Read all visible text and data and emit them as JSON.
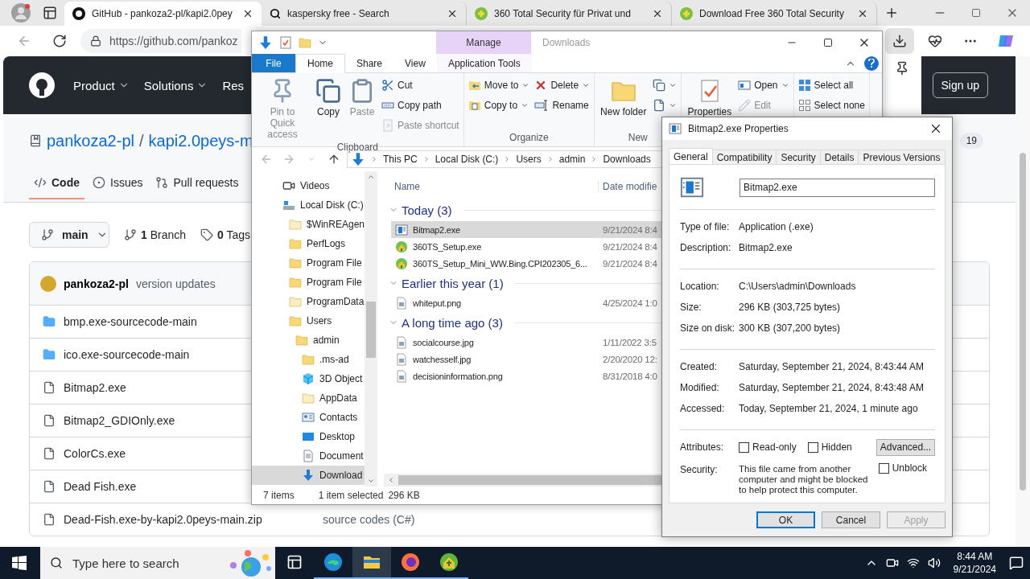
{
  "browser": {
    "tabs": [
      {
        "title": "GitHub - pankoza2-pl/kapi2.0pey",
        "kind": "github",
        "selected": true
      },
      {
        "title": "kaspersky free - Search",
        "kind": "search",
        "selected": false
      },
      {
        "title": "360 Total Security für Privat und",
        "kind": "shield",
        "selected": false
      },
      {
        "title": "Download Free 360 Total Security",
        "kind": "shield",
        "selected": false
      }
    ],
    "url": "https://github.com/pankoz"
  },
  "github": {
    "nav": [
      {
        "label": "Product",
        "dropdown": true
      },
      {
        "label": "Solutions",
        "dropdown": true
      },
      {
        "label": "Res",
        "dropdown": false
      }
    ],
    "sign_up": "Sign up",
    "owner": "pankoza2-pl",
    "separator": "/",
    "repo": "kapi2.0peys-m",
    "star_count": "19",
    "tabs": [
      {
        "label": "Code",
        "kind": "code",
        "selected": true
      },
      {
        "label": "Issues",
        "kind": "issues",
        "selected": false
      },
      {
        "label": "Pull requests",
        "kind": "pulls",
        "selected": false
      }
    ],
    "branch": "main",
    "branches": "**1** Branch",
    "tags": "**0** Tags",
    "commit": {
      "author": "pankoza2-pl",
      "message": "version updates"
    },
    "files": [
      {
        "name": "bmp.exe-sourcecode-main",
        "kind": "folder"
      },
      {
        "name": "ico.exe-sourcecode-main",
        "kind": "folder"
      },
      {
        "name": "Bitmap2.exe",
        "kind": "file"
      },
      {
        "name": "Bitmap2_GDIOnly.exe",
        "kind": "file"
      },
      {
        "name": "ColorCs.exe",
        "kind": "file"
      },
      {
        "name": "Dead Fish.exe",
        "kind": "file"
      },
      {
        "name": "Dead-Fish.exe-by-kapi2.0peys-main.zip",
        "kind": "file",
        "message": "source codes (C#)"
      }
    ]
  },
  "explorer": {
    "title": "Downloads",
    "contextual_group": "Manage",
    "ribbon_tabs": [
      {
        "label": "File",
        "kind": "file",
        "selected": false
      },
      {
        "label": "Home",
        "kind": "tab",
        "selected": true
      },
      {
        "label": "Share",
        "kind": "tab",
        "selected": false
      },
      {
        "label": "View",
        "kind": "tab",
        "selected": false
      },
      {
        "label": "Application Tools",
        "kind": "contextual",
        "selected": false
      }
    ],
    "ribbon": [
      {
        "label": "Clipboard",
        "columns": [
          [
            {
              "kind": "pin",
              "label": "Pin to Quick access",
              "disabled": true,
              "dropdown": false
            }
          ],
          [
            {
              "kind": "copy",
              "label": "Copy",
              "disabled": false,
              "dropdown": false
            }
          ],
          [
            {
              "kind": "paste",
              "label": "Paste",
              "disabled": true,
              "dropdown": false
            }
          ],
          [
            {
              "kind": "cut",
              "label": "Cut",
              "disabled": false,
              "dropdown": false
            },
            {
              "kind": "copy-path",
              "label": "Copy path",
              "disabled": false,
              "dropdown": false
            },
            {
              "kind": "paste-shortcut",
              "label": "Paste shortcut",
              "disabled": true,
              "dropdown": false
            }
          ]
        ]
      },
      {
        "label": "Organize",
        "columns": [
          [
            {
              "kind": "move",
              "label": "Move to",
              "disabled": false,
              "dropdown": true
            },
            {
              "kind": "copy-to",
              "label": "Copy to",
              "disabled": false,
              "dropdown": true
            }
          ],
          [
            {
              "kind": "delete",
              "label": "Delete",
              "disabled": false,
              "dropdown": true
            },
            {
              "kind": "rename",
              "label": "Rename",
              "disabled": false,
              "dropdown": false
            }
          ]
        ]
      },
      {
        "label": "New",
        "columns": [
          [
            {
              "kind": "new-folder",
              "label": "New folder",
              "disabled": false,
              "dropdown": false
            }
          ],
          [
            {
              "kind": "new-item",
              "disabled": false,
              "dropdown": true
            },
            {
              "kind": "easy-access",
              "disabled": false,
              "dropdown": true
            }
          ]
        ]
      },
      {
        "columns": [
          [
            {
              "kind": "properties",
              "label": "Properties",
              "disabled": false,
              "dropdown": false
            }
          ],
          [
            {
              "kind": "open",
              "label": "Open",
              "disabled": false,
              "dropdown": true
            },
            {
              "kind": "edit",
              "label": "Edit",
              "disabled": true,
              "dropdown": false
            }
          ]
        ]
      },
      {
        "columns": [
          [
            {
              "kind": "select-all",
              "label": "Select all",
              "disabled": false,
              "dropdown": false
            },
            {
              "kind": "select-none",
              "label": "Select none",
              "disabled": false,
              "dropdown": false
            }
          ]
        ]
      }
    ],
    "path": [
      "This PC",
      "Local Disk (C:)",
      "Users",
      "admin",
      "Downloads"
    ],
    "nav": [
      {
        "label": "Videos",
        "kind": "videos",
        "selected": false
      },
      {
        "label": "Local Disk (C:)",
        "kind": "drive",
        "selected": false,
        "children": [
          {
            "label": "$WinREAgen",
            "kind": "folder-faded",
            "selected": false
          },
          {
            "label": "PerfLogs",
            "kind": "folder",
            "selected": false
          },
          {
            "label": "Program File",
            "kind": "folder",
            "selected": false
          },
          {
            "label": "Program File",
            "kind": "folder",
            "selected": false
          },
          {
            "label": "ProgramData",
            "kind": "folder-faded",
            "selected": false
          },
          {
            "label": "Users",
            "kind": "folder",
            "selected": false,
            "children": [
              {
                "label": "admin",
                "kind": "folder",
                "selected": false,
                "children": [
                  {
                    "label": ".ms-ad",
                    "kind": "folder",
                    "selected": false
                  },
                  {
                    "label": "3D Object",
                    "kind": "cube",
                    "selected": false
                  },
                  {
                    "label": "AppData",
                    "kind": "folder-faded",
                    "selected": false
                  },
                  {
                    "label": "Contacts",
                    "kind": "contacts",
                    "selected": false
                  },
                  {
                    "label": "Desktop",
                    "kind": "desktop",
                    "selected": false
                  },
                  {
                    "label": "Document",
                    "kind": "documents",
                    "selected": false
                  },
                  {
                    "label": "Download",
                    "kind": "downloads",
                    "selected": true
                  }
                ]
              }
            ]
          }
        ]
      }
    ],
    "columns": [
      "Name",
      "Date modifie"
    ],
    "groups": [
      {
        "title": "Today (3)",
        "expanded": true,
        "files": [
          {
            "name": "Bitmap2.exe",
            "date": "9/21/2024 8:4",
            "kind": "app",
            "selected": true
          },
          {
            "name": "360TS_Setup.exe",
            "date": "9/21/2024 8:4",
            "kind": "installer",
            "selected": false
          },
          {
            "name": "360TS_Setup_Mini_WW.Bing.CPI202305_6...",
            "date": "9/21/2024 8:4",
            "kind": "installer",
            "selected": false
          }
        ]
      },
      {
        "title": "Earlier this year (1)",
        "expanded": true,
        "files": [
          {
            "name": "whiteput.png",
            "date": "4/25/2024 1:0",
            "kind": "image",
            "selected": false
          }
        ]
      },
      {
        "title": "A long time ago (3)",
        "expanded": true,
        "files": [
          {
            "name": "socialcourse.jpg",
            "date": "1/11/2022 3:5",
            "kind": "image",
            "selected": false
          },
          {
            "name": "watchesself.jpg",
            "date": "2/20/2020 12:",
            "kind": "image",
            "selected": false
          },
          {
            "name": "decisioninformation.png",
            "date": "8/31/2018 4:0",
            "kind": "image",
            "selected": false
          }
        ]
      }
    ],
    "status": {
      "count": "7 items",
      "selection": "1 item selected",
      "size": "296 KB"
    }
  },
  "dialog": {
    "title": "Bitmap2.exe Properties",
    "tabs": [
      {
        "label": "General",
        "selected": true
      },
      {
        "label": "Compatibility",
        "selected": false
      },
      {
        "label": "Security",
        "selected": false
      },
      {
        "label": "Details",
        "selected": false
      },
      {
        "label": "Previous Versions",
        "selected": false
      }
    ],
    "file_name": "Bitmap2.exe",
    "sections": [
      [
        {
          "label": "Type of file:",
          "value": "Application (.exe)"
        },
        {
          "label": "Description:",
          "value": "Bitmap2.exe"
        }
      ],
      [
        {
          "label": "Location:",
          "value": "C:\\Users\\admin\\Downloads"
        },
        {
          "label": "Size:",
          "value": "296 KB (303,725 bytes)"
        },
        {
          "label": "Size on disk:",
          "value": "300 KB (307,200 bytes)"
        }
      ],
      [
        {
          "label": "Created:",
          "value": "Saturday, September 21, 2024, 8:43:44 AM"
        },
        {
          "label": "Modified:",
          "value": "Saturday, September 21, 2024, 8:43:48 AM"
        },
        {
          "label": "Accessed:",
          "value": "Today, September 21, 2024, 1 minute ago"
        }
      ]
    ],
    "attributes_label": "Attributes:",
    "attributes": [
      {
        "label": "Read-only",
        "checked": false
      },
      {
        "label": "Hidden",
        "checked": false
      }
    ],
    "advanced": "Advanced...",
    "security_label": "Security:",
    "security_text": "This file came from another computer and might be blocked to help protect this computer.",
    "unblock": {
      "label": "Unblock",
      "checked": false
    },
    "buttons": [
      {
        "label": "OK",
        "default": true,
        "disabled": false
      },
      {
        "label": "Cancel",
        "default": false,
        "disabled": false
      },
      {
        "label": "Apply",
        "default": false,
        "disabled": true
      }
    ]
  },
  "taskbar": {
    "search_placeholder": "Type here to search",
    "apps": [
      {
        "kind": "taskview",
        "running": false,
        "active": false
      },
      {
        "kind": "edge",
        "running": true,
        "active": false
      },
      {
        "kind": "explorer",
        "running": true,
        "active": true
      },
      {
        "kind": "firefox",
        "running": true,
        "active": false
      },
      {
        "kind": "installer",
        "running": true,
        "active": false
      }
    ],
    "time": "8:44 AM",
    "date": "9/21/2024"
  }
}
